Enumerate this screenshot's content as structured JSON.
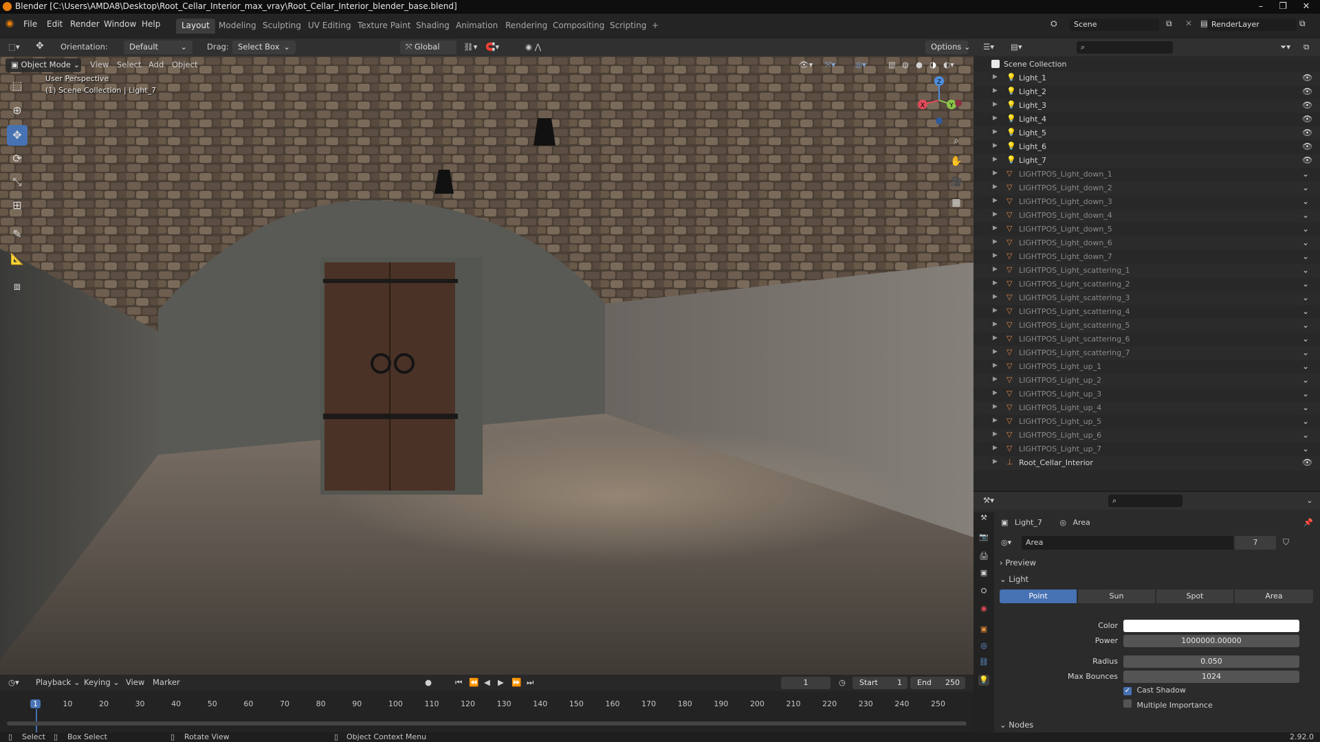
{
  "window": {
    "title": "Blender [C:\\Users\\AMDA8\\Desktop\\Root_Cellar_Interior_max_vray\\Root_Cellar_Interior_blender_base.blend]",
    "controls": [
      "–",
      "❐",
      "✕"
    ]
  },
  "menubar": {
    "menus": [
      "File",
      "Edit",
      "Render",
      "Window",
      "Help"
    ],
    "workspaces": [
      "Layout",
      "Modeling",
      "Sculpting",
      "UV Editing",
      "Texture Paint",
      "Shading",
      "Animation",
      "Rendering",
      "Compositing",
      "Scripting"
    ],
    "active_workspace": "Layout",
    "add_tab": "+",
    "scene": "Scene",
    "render_layer": "RenderLayer"
  },
  "toolheader": {
    "orientation_label": "Orientation:",
    "orientation_value": "Default",
    "drag_label": "Drag:",
    "drag_value": "Select Box",
    "transform_space": "Global",
    "options": "Options"
  },
  "viewport": {
    "mode": "Object Mode",
    "menus": [
      "View",
      "Select",
      "Add",
      "Object"
    ],
    "overlay_line1": "User Perspective",
    "overlay_line2": "(1) Scene Collection | Light_7",
    "gizmo_axes": {
      "x": "X",
      "y": "Y",
      "z": "Z"
    }
  },
  "outliner": {
    "root": "Scene Collection",
    "items": [
      {
        "name": "Light_1",
        "type": "light",
        "visible": true
      },
      {
        "name": "Light_2",
        "type": "light",
        "visible": true
      },
      {
        "name": "Light_3",
        "type": "light",
        "visible": true
      },
      {
        "name": "Light_4",
        "type": "light",
        "visible": true
      },
      {
        "name": "Light_5",
        "type": "light",
        "visible": true
      },
      {
        "name": "Light_6",
        "type": "light",
        "visible": true
      },
      {
        "name": "Light_7",
        "type": "light",
        "visible": true
      },
      {
        "name": "LIGHTPOS_Light_down_1",
        "type": "mesh",
        "visible": false
      },
      {
        "name": "LIGHTPOS_Light_down_2",
        "type": "mesh",
        "visible": false
      },
      {
        "name": "LIGHTPOS_Light_down_3",
        "type": "mesh",
        "visible": false
      },
      {
        "name": "LIGHTPOS_Light_down_4",
        "type": "mesh",
        "visible": false
      },
      {
        "name": "LIGHTPOS_Light_down_5",
        "type": "mesh",
        "visible": false
      },
      {
        "name": "LIGHTPOS_Light_down_6",
        "type": "mesh",
        "visible": false
      },
      {
        "name": "LIGHTPOS_Light_down_7",
        "type": "mesh",
        "visible": false
      },
      {
        "name": "LIGHTPOS_Light_scattering_1",
        "type": "mesh",
        "visible": false
      },
      {
        "name": "LIGHTPOS_Light_scattering_2",
        "type": "mesh",
        "visible": false
      },
      {
        "name": "LIGHTPOS_Light_scattering_3",
        "type": "mesh",
        "visible": false
      },
      {
        "name": "LIGHTPOS_Light_scattering_4",
        "type": "mesh",
        "visible": false
      },
      {
        "name": "LIGHTPOS_Light_scattering_5",
        "type": "mesh",
        "visible": false
      },
      {
        "name": "LIGHTPOS_Light_scattering_6",
        "type": "mesh",
        "visible": false
      },
      {
        "name": "LIGHTPOS_Light_scattering_7",
        "type": "mesh",
        "visible": false
      },
      {
        "name": "LIGHTPOS_Light_up_1",
        "type": "mesh",
        "visible": false
      },
      {
        "name": "LIGHTPOS_Light_up_2",
        "type": "mesh",
        "visible": false
      },
      {
        "name": "LIGHTPOS_Light_up_3",
        "type": "mesh",
        "visible": false
      },
      {
        "name": "LIGHTPOS_Light_up_4",
        "type": "mesh",
        "visible": false
      },
      {
        "name": "LIGHTPOS_Light_up_5",
        "type": "mesh",
        "visible": false
      },
      {
        "name": "LIGHTPOS_Light_up_6",
        "type": "mesh",
        "visible": false
      },
      {
        "name": "LIGHTPOS_Light_up_7",
        "type": "mesh",
        "visible": false
      },
      {
        "name": "Root_Cellar_Interior",
        "type": "empty",
        "visible": true
      }
    ]
  },
  "properties": {
    "object_name": "Light_7",
    "data_name": "Area",
    "datablock": "Area",
    "users": "7",
    "sections": {
      "preview": "Preview",
      "light": "Light",
      "nodes": "Nodes"
    },
    "light_types": [
      "Point",
      "Sun",
      "Spot",
      "Area"
    ],
    "active_light_type": "Point",
    "color_label": "Color",
    "color_value": "#ffffff",
    "power_label": "Power",
    "power_value": "1000000.00000",
    "radius_label": "Radius",
    "radius_value": "0.050",
    "max_bounces_label": "Max Bounces",
    "max_bounces_value": "1024",
    "cast_shadow_label": "Cast Shadow",
    "cast_shadow": true,
    "multiple_importance_label": "Multiple Importance",
    "multiple_importance": false
  },
  "timeline": {
    "menus": [
      "Playback",
      "Keying",
      "View",
      "Marker"
    ],
    "current_frame": "1",
    "start_label": "Start",
    "start_value": "1",
    "end_label": "End",
    "end_value": "250",
    "ruler": [
      "1",
      "10",
      "20",
      "30",
      "40",
      "50",
      "60",
      "70",
      "80",
      "90",
      "100",
      "110",
      "120",
      "130",
      "140",
      "150",
      "160",
      "170",
      "180",
      "190",
      "200",
      "210",
      "220",
      "230",
      "240",
      "250"
    ]
  },
  "statusbar": {
    "select": "Select",
    "box_select": "Box Select",
    "rotate_view": "Rotate View",
    "context_menu": "Object Context Menu",
    "version": "2.92.0"
  },
  "colors": {
    "accent": "#4772b3",
    "light_icon": "#e8a060",
    "mesh_icon": "#e0874a",
    "collection_icon": "#8fd19e"
  }
}
